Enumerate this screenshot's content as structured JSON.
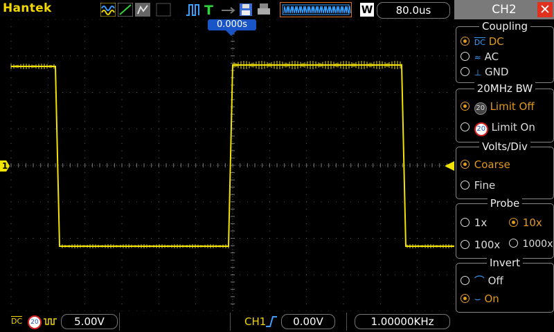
{
  "brand": "Hantek",
  "timebase": "80.0us",
  "mode_button": "W",
  "trigger_position": "0.000s",
  "channel_marker": "1",
  "panel": {
    "title": "CH2",
    "coupling": {
      "title": "Coupling",
      "options": [
        "DC",
        "AC",
        "GND"
      ],
      "selected": "DC"
    },
    "bw": {
      "title": "20MHz BW",
      "options": [
        "Limit Off",
        "Limit On"
      ],
      "selected": "Limit Off"
    },
    "volts": {
      "title": "Volts/Div",
      "options": [
        "Coarse",
        "Fine"
      ],
      "selected": "Coarse"
    },
    "probe": {
      "title": "Probe",
      "options": [
        "1x",
        "10x",
        "100x",
        "1000x"
      ],
      "selected": "10x"
    },
    "invert": {
      "title": "Invert",
      "options": [
        "Off",
        "On"
      ],
      "selected": "On"
    }
  },
  "bottom": {
    "coupling_icon": "DC",
    "bw_icon": "20",
    "volts_div": "5.00V",
    "trigger_source": "CH1",
    "trigger_level": "0.00V",
    "frequency": "1.00000KHz"
  },
  "colors": {
    "trace": "#f2e400",
    "accent": "#e09a1c",
    "brand": "#f2d600",
    "panel_title": "#7a7a7a"
  }
}
